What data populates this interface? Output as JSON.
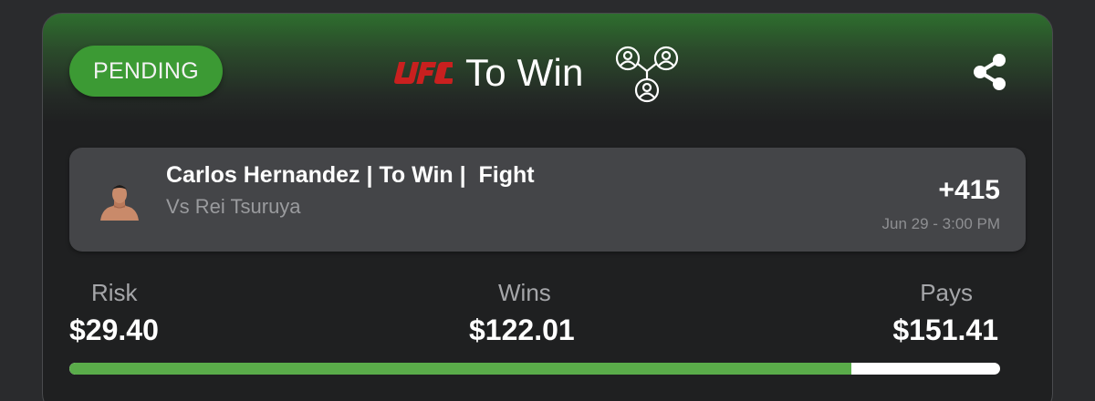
{
  "status": {
    "label": "PENDING",
    "color": "#3c9a34"
  },
  "header": {
    "league_logo": "UFC",
    "title": "To Win",
    "group_icon": "network-users-icon",
    "share_icon": "share-icon"
  },
  "leg": {
    "avatar": "fighter-avatar",
    "title": "Carlos Hernandez | To Win |  Fight",
    "subtitle": "Vs Rei Tsuruya",
    "odds": "+415",
    "time": "Jun 29 - 3:00 PM"
  },
  "stats": {
    "risk": {
      "label": "Risk",
      "value": "$29.40"
    },
    "wins": {
      "label": "Wins",
      "value": "$122.01"
    },
    "pays": {
      "label": "Pays",
      "value": "$151.41"
    }
  },
  "progress": {
    "fraction": 0.84,
    "fill_color": "#5aac4a",
    "track_color": "#ffffff"
  }
}
